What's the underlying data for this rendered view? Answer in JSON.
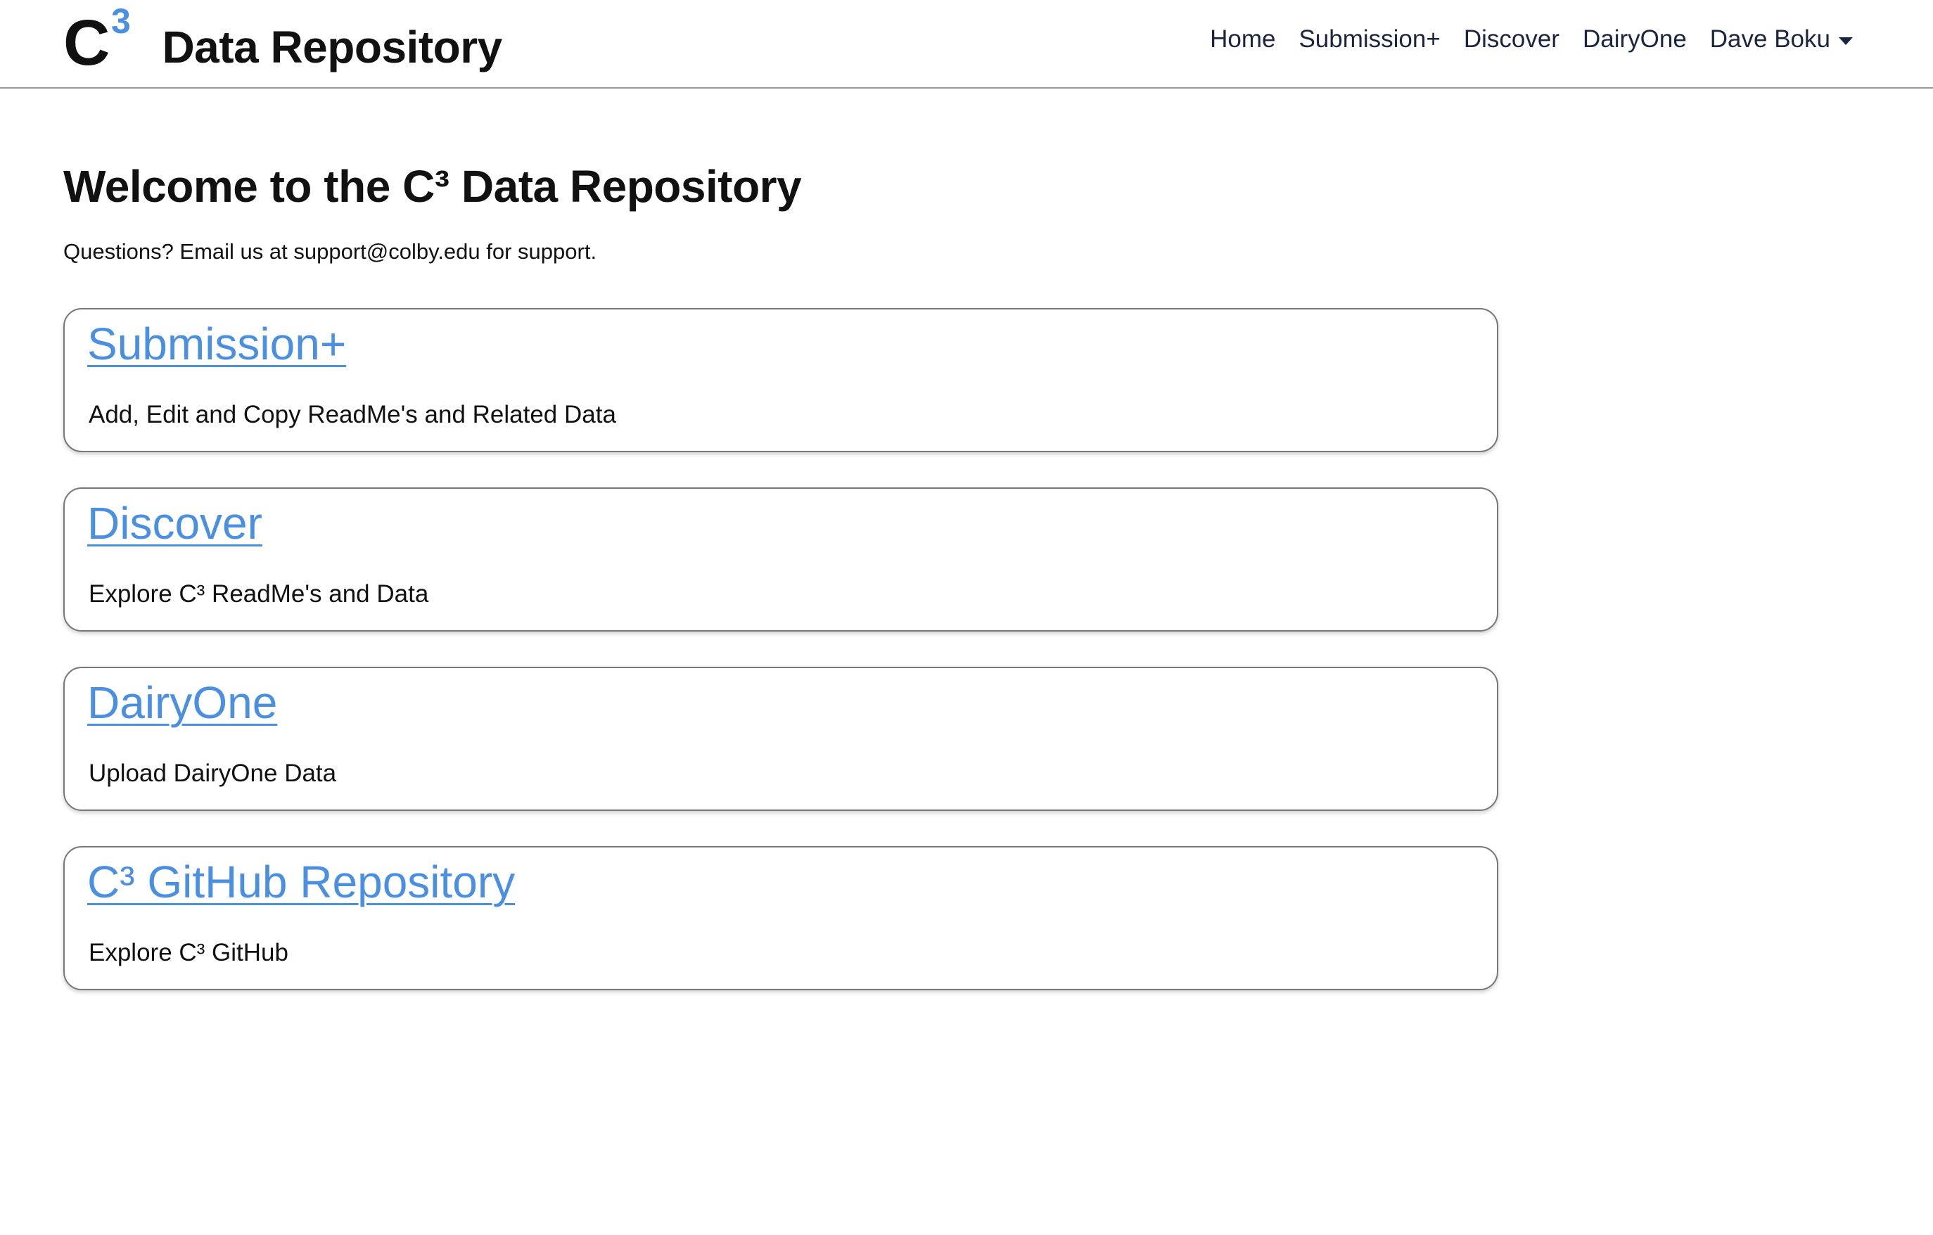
{
  "navbar": {
    "brand": {
      "mark_letter": "C",
      "mark_superscript": "3",
      "text": "Data Repository",
      "superscript_color": "#4a8fe0"
    },
    "links": [
      {
        "label": "Home"
      },
      {
        "label": "Submission+"
      },
      {
        "label": "Discover"
      },
      {
        "label": "DairyOne"
      },
      {
        "label": "Dave Boku",
        "icon": "caret-down-icon"
      }
    ]
  },
  "main": {
    "title": "Welcome to the C³ Data Repository",
    "subtitle": "Questions? Email us at support@colby.edu for support.",
    "cards": [
      {
        "title": "Submission+",
        "description": "Add, Edit and Copy ReadMe's and Related Data"
      },
      {
        "title": "Discover",
        "description": "Explore C³ ReadMe's and Data"
      },
      {
        "title": "DairyOne",
        "description": "Upload DairyOne Data"
      },
      {
        "title": "C³ GitHub Repository",
        "description": "Explore C³ GitHub"
      }
    ]
  },
  "colors": {
    "link": "#4a8fe0",
    "text": "#111111",
    "nav_text": "#1b2540",
    "card_border": "#777777"
  }
}
